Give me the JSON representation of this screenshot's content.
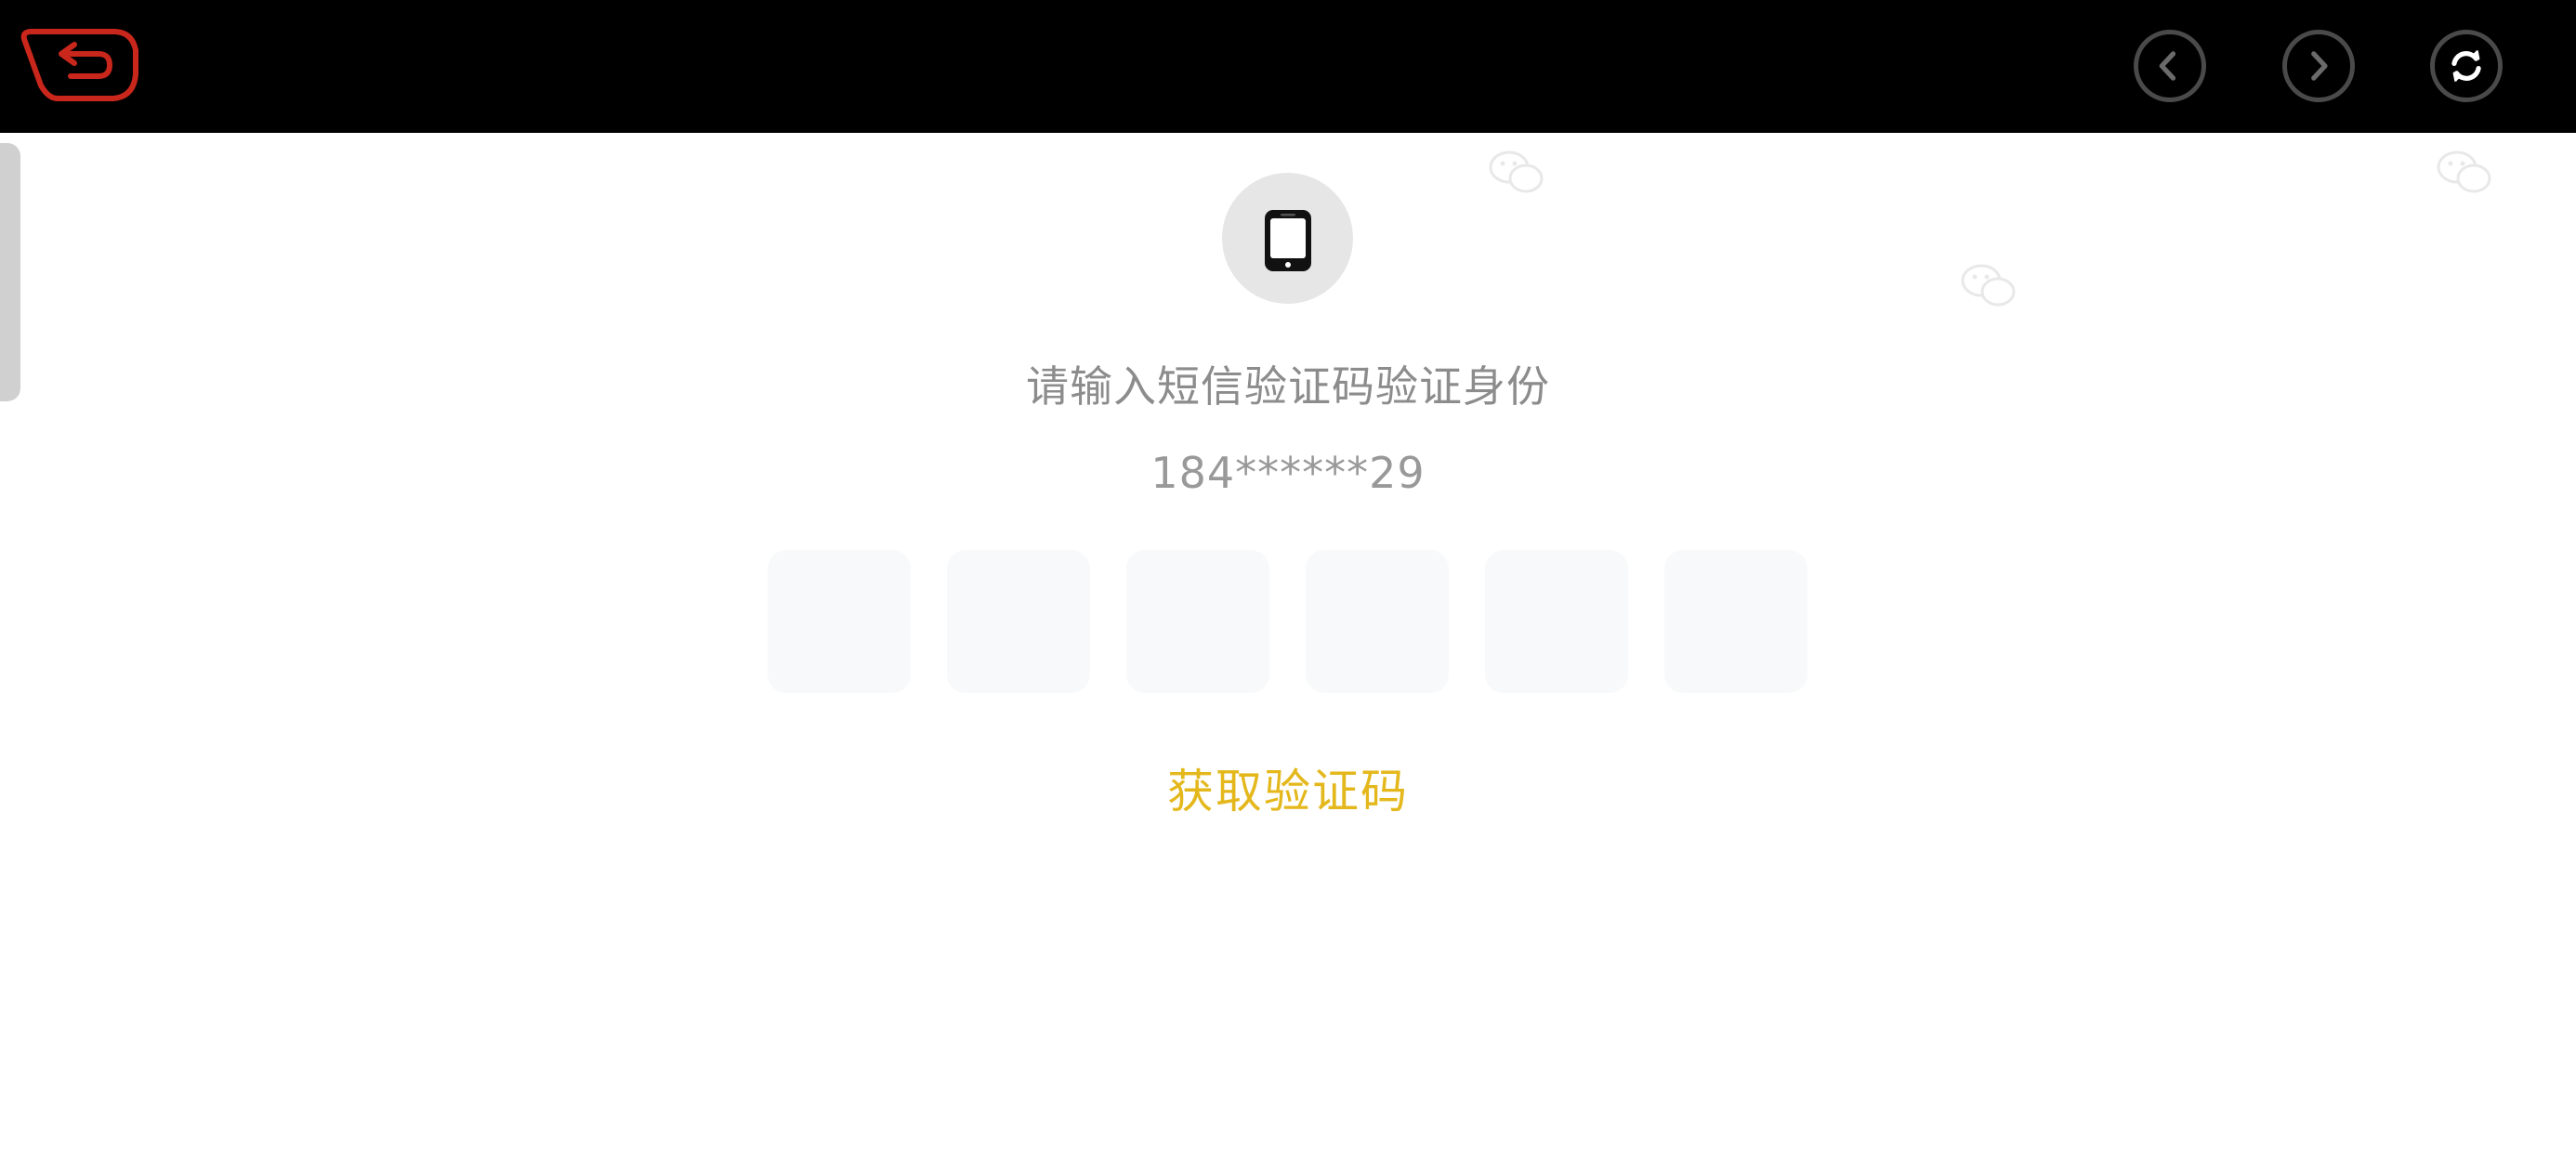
{
  "topbar": {
    "back_icon": "back-arrow-icon",
    "back_color": "#c9271c",
    "prev_icon": "chevron-left-icon",
    "next_icon": "chevron-right-icon",
    "refresh_icon": "refresh-icon"
  },
  "verification": {
    "icon": "mobile-phone-icon",
    "prompt": "请输入短信验证码验证身份",
    "phone_number": "184******29",
    "code_digits": [
      "",
      "",
      "",
      "",
      "",
      ""
    ],
    "get_code_label": "获取验证码",
    "accent_color": "#e4b81c"
  },
  "watermark_icon": "wechat-icon"
}
